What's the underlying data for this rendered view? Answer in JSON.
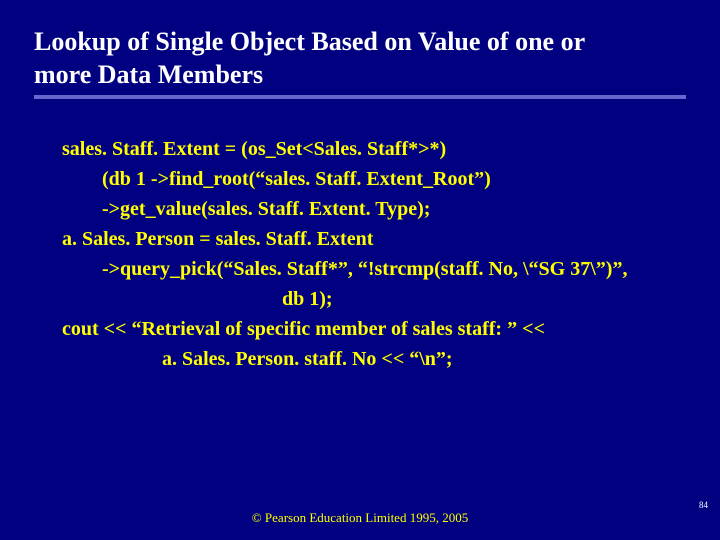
{
  "title": {
    "line1": "Lookup of Single Object Based on Value of one or",
    "line2": "more Data Members"
  },
  "code": {
    "l1": "sales. Staff. Extent = (os_Set<Sales. Staff*>*)",
    "l2": "(db 1 ->find_root(“sales. Staff. Extent_Root”)",
    "l3": "->get_value(sales. Staff. Extent. Type);",
    "l4": "a. Sales. Person = sales. Staff. Extent",
    "l5": "->query_pick(“Sales. Staff*”, “!strcmp(staff. No, \\“SG 37\\”)”,",
    "l6": "db 1);",
    "l7": "cout << “Retrieval of specific member of sales staff: ” <<",
    "l8": "a. Sales. Person. staff. No << “\\n”;"
  },
  "footer": "© Pearson Education Limited 1995, 2005",
  "pagenum": "84"
}
